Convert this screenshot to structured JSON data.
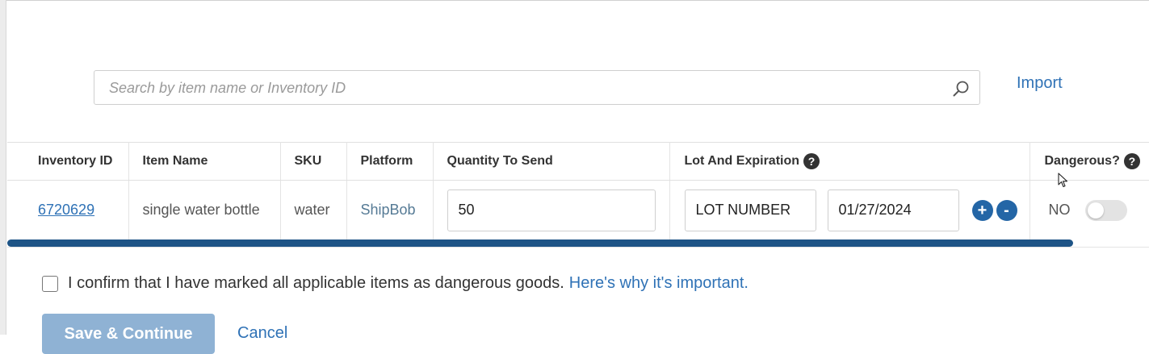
{
  "search": {
    "placeholder": "Search by item name or Inventory ID"
  },
  "import_label": "Import",
  "table": {
    "headers": {
      "inventory_id": "Inventory ID",
      "item_name": "Item Name",
      "sku": "SKU",
      "platform": "Platform",
      "quantity": "Quantity To Send",
      "lot": "Lot And Expiration",
      "dangerous": "Dangerous?"
    },
    "row": {
      "inventory_id": "6720629",
      "item_name": "single water bottle",
      "sku": "water",
      "platform": "ShipBob",
      "quantity": "50",
      "lot_number": "LOT NUMBER",
      "expiration": "01/27/2024",
      "dangerous": "NO"
    }
  },
  "icons": {
    "help": "?",
    "plus": "+",
    "minus": "-"
  },
  "confirm": {
    "text": "I confirm that I have marked all applicable items as dangerous goods.",
    "link": "Here's why it's important."
  },
  "buttons": {
    "save": "Save & Continue",
    "cancel": "Cancel"
  },
  "colors": {
    "accent": "#2f72b6",
    "scrollbar": "#1e5486",
    "round_button": "#2466a6",
    "save_disabled": "#8fb2d4"
  }
}
